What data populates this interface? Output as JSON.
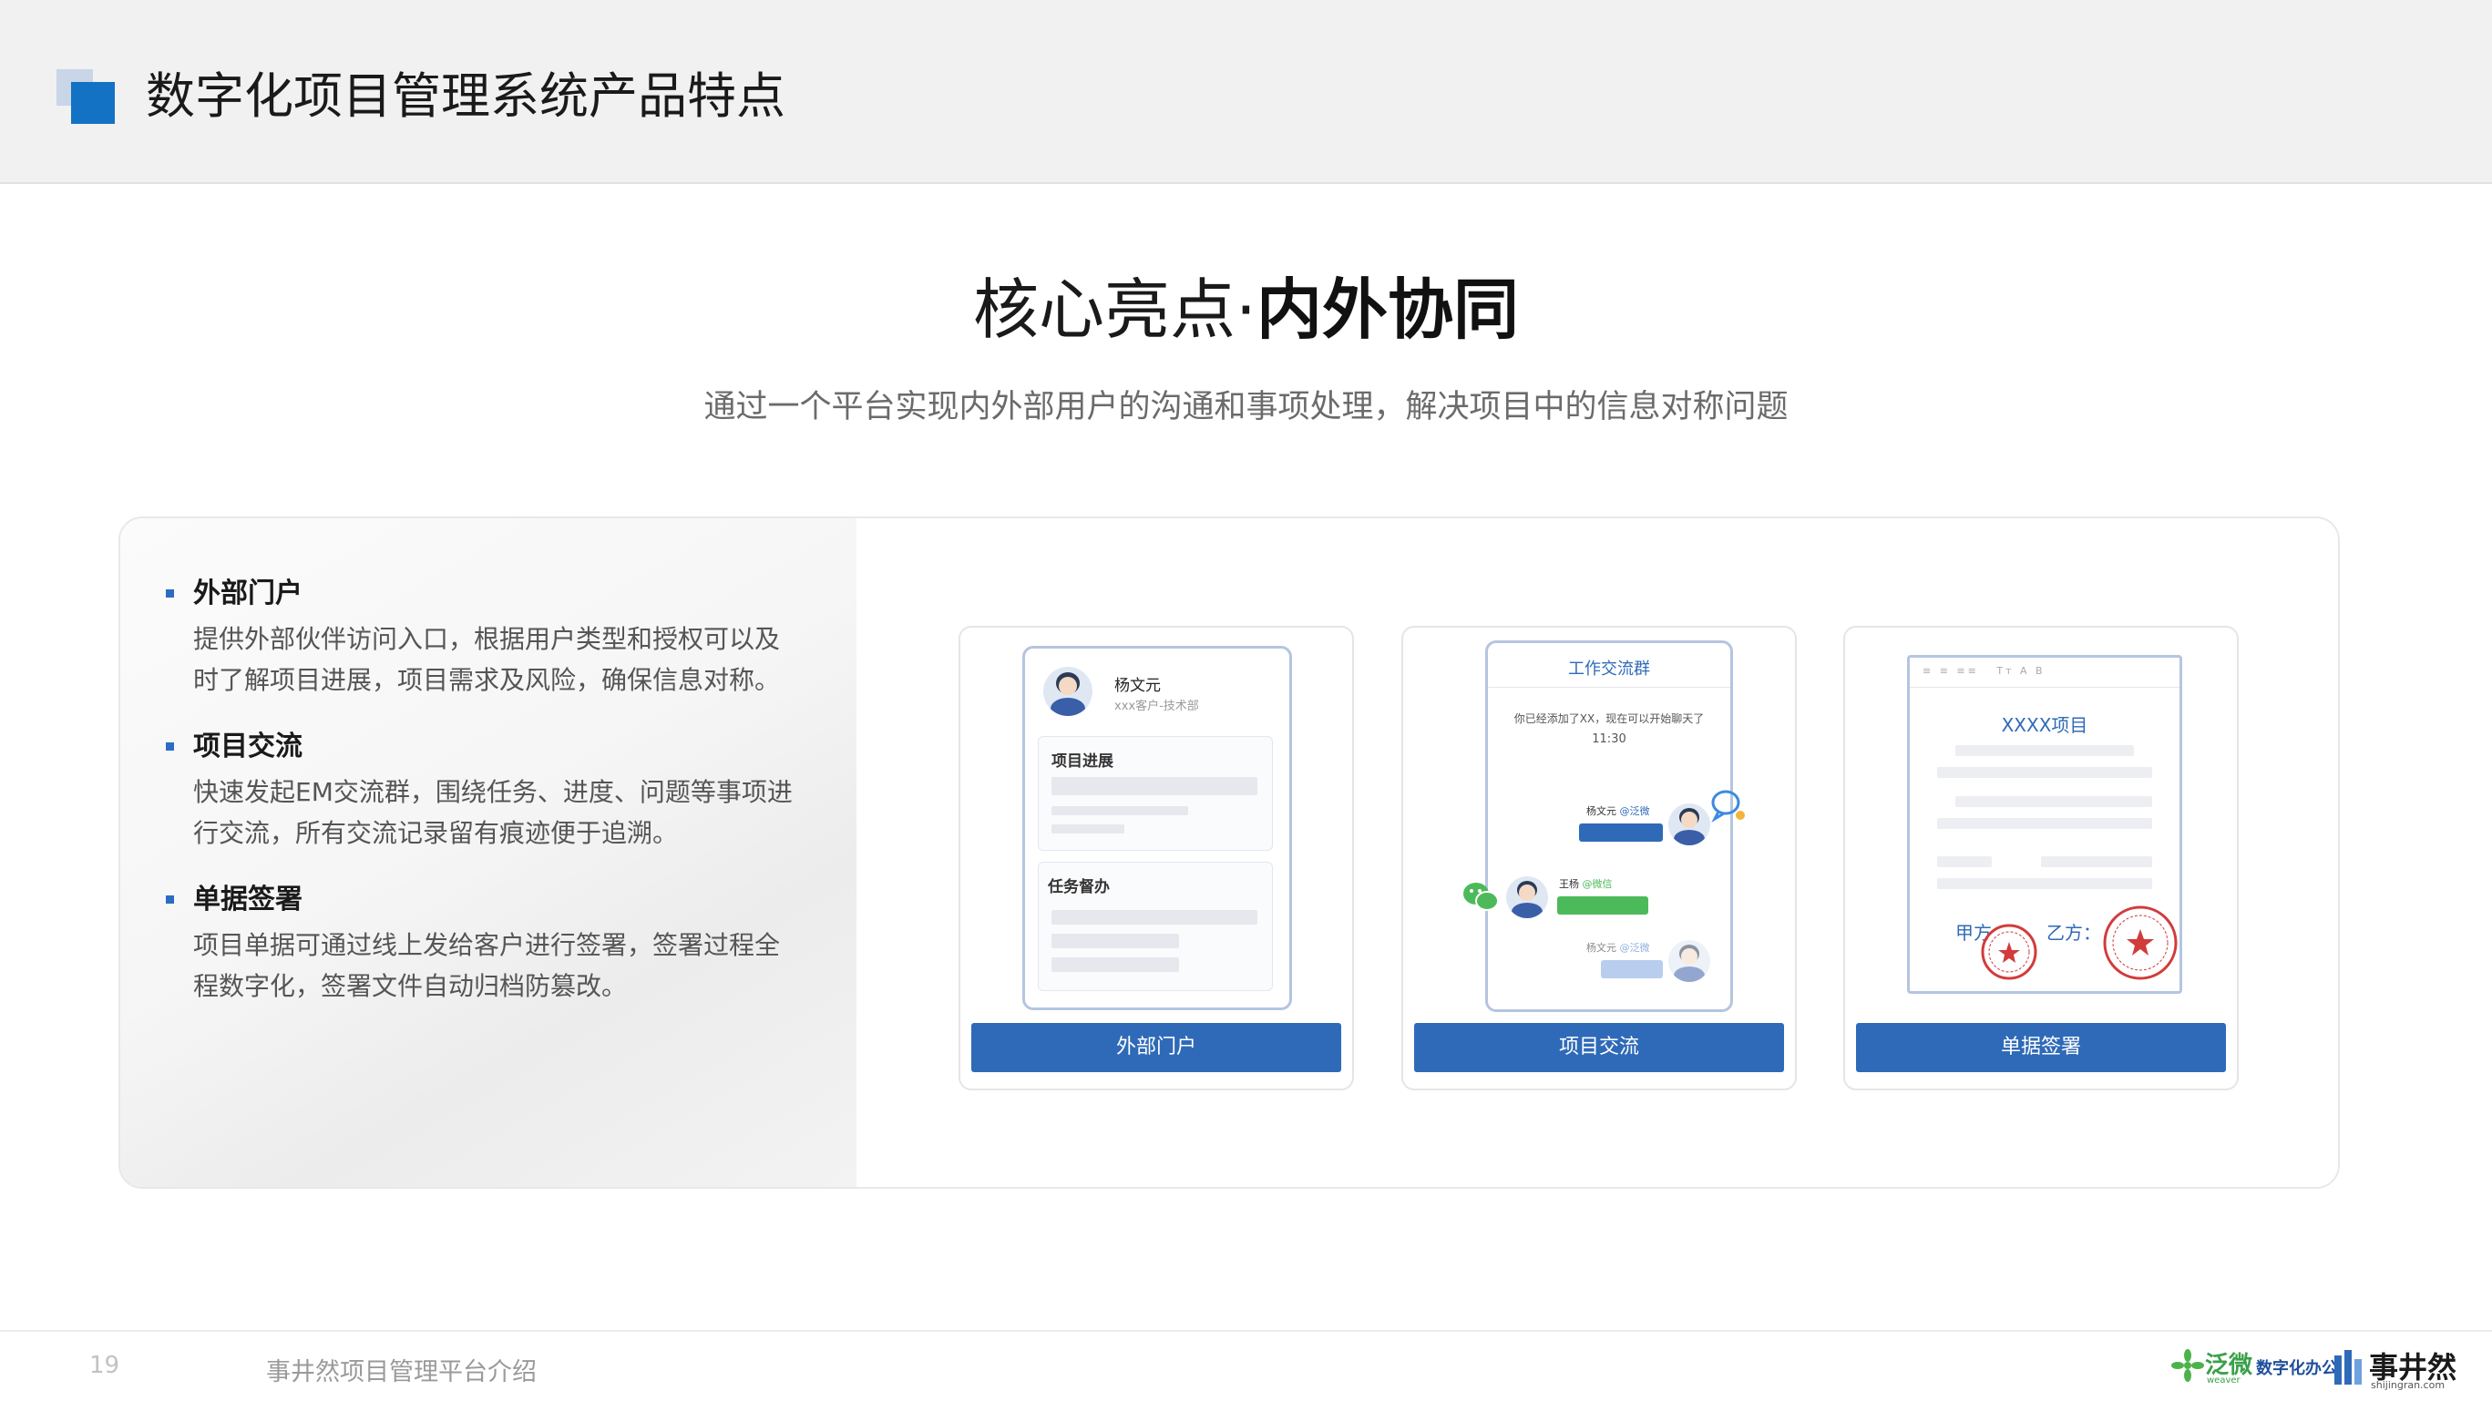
{
  "header": {
    "title": "数字化项目管理系统产品特点"
  },
  "headline": {
    "light": "核心亮点·",
    "bold": "内外协同"
  },
  "subtitle": "通过一个平台实现内外部用户的沟通和事项处理，解决项目中的信息对称问题",
  "features": [
    {
      "title": "外部门户",
      "desc": "提供外部伙伴访问入口，根据用户类型和授权可以及时了解项目进展，项目需求及风险，确保信息对称。"
    },
    {
      "title": "项目交流",
      "desc": "快速发起EM交流群，围绕任务、进度、问题等事项进行交流，所有交流记录留有痕迹便于追溯。"
    },
    {
      "title": "单据签署",
      "desc": "项目单据可通过线上发给客户进行签署，签署过程全程数字化，签署文件自动归档防篡改。"
    }
  ],
  "cards": {
    "portal": {
      "button": "外部门户",
      "user_name": "杨文元",
      "user_role": "xxx客户-技术部",
      "section1": "项目进展",
      "section2": "任务督办"
    },
    "chat": {
      "button": "项目交流",
      "group_title": "工作交流群",
      "system_msg": "你已经添加了XX，现在可以开始聊天了",
      "time": "11:30",
      "msg1_name": "杨文元",
      "msg1_tag": "@泛微",
      "msg2_name": "王杨",
      "msg2_tag": "@微信",
      "msg3_name": "杨文元",
      "msg3_tag": "@泛微"
    },
    "sign": {
      "button": "单据签署",
      "toolbar": "Tт A B",
      "doc_title": "XXXX项目",
      "party_a": "甲方",
      "party_b": "乙方："
    }
  },
  "footer": {
    "page_number": "19",
    "text": "事井然项目管理平台介绍",
    "logo1_brand": "泛微",
    "logo1_sub": "weaver",
    "logo1_tag": "数字化办公",
    "logo2_brand": "事井然",
    "logo2_url": "shijingran.com"
  },
  "colors": {
    "accent_blue": "#1472c4",
    "button_blue": "#2f6ab8",
    "stamp_red": "#d23b3b",
    "wechat_green": "#4cba5a"
  }
}
